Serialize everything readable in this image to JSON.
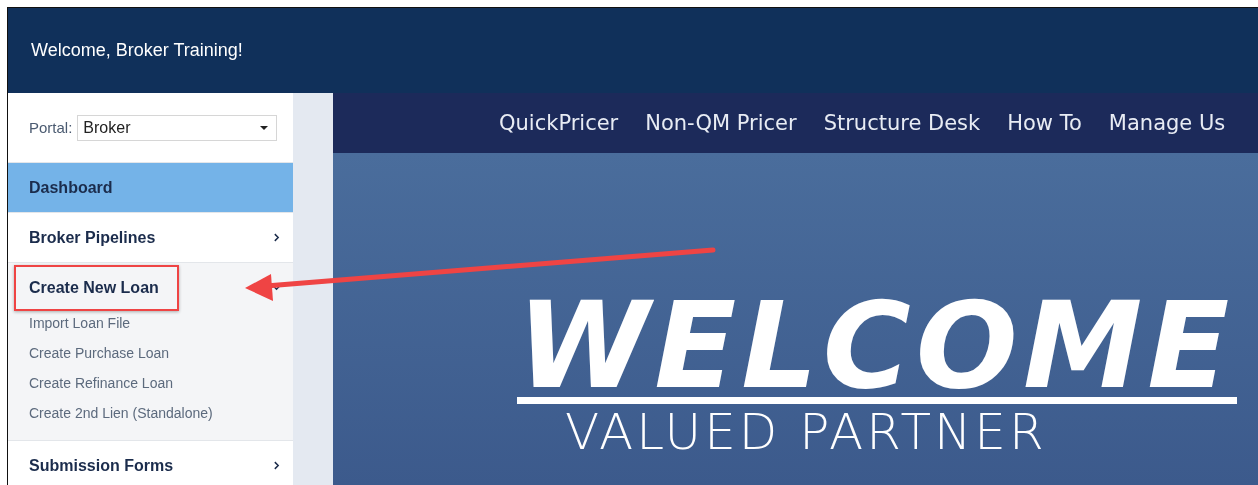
{
  "header": {
    "welcome": "Welcome, Broker Training!"
  },
  "sidebar": {
    "portal": {
      "label": "Portal:",
      "value": "Broker"
    },
    "items": [
      {
        "label": "Dashboard",
        "kind": "link",
        "selected": true,
        "highlighted": false
      },
      {
        "label": "Broker Pipelines",
        "kind": "group",
        "selected": false,
        "expanded": false,
        "highlighted": false
      },
      {
        "label": "Create New Loan",
        "kind": "group",
        "selected": false,
        "expanded": true,
        "highlighted": true,
        "children": [
          {
            "label": "Import Loan File"
          },
          {
            "label": "Create Purchase Loan"
          },
          {
            "label": "Create Refinance Loan"
          },
          {
            "label": "Create 2nd Lien (Standalone)"
          }
        ]
      },
      {
        "label": "Submission Forms",
        "kind": "group",
        "selected": false,
        "expanded": false,
        "highlighted": false
      }
    ]
  },
  "nav": [
    "QuickPricer",
    "Non-QM Pricer",
    "Structure Desk",
    "How To",
    "Manage Us"
  ],
  "hero": {
    "title": "WELCOME",
    "subtitle": "VALUED PARTNER"
  }
}
